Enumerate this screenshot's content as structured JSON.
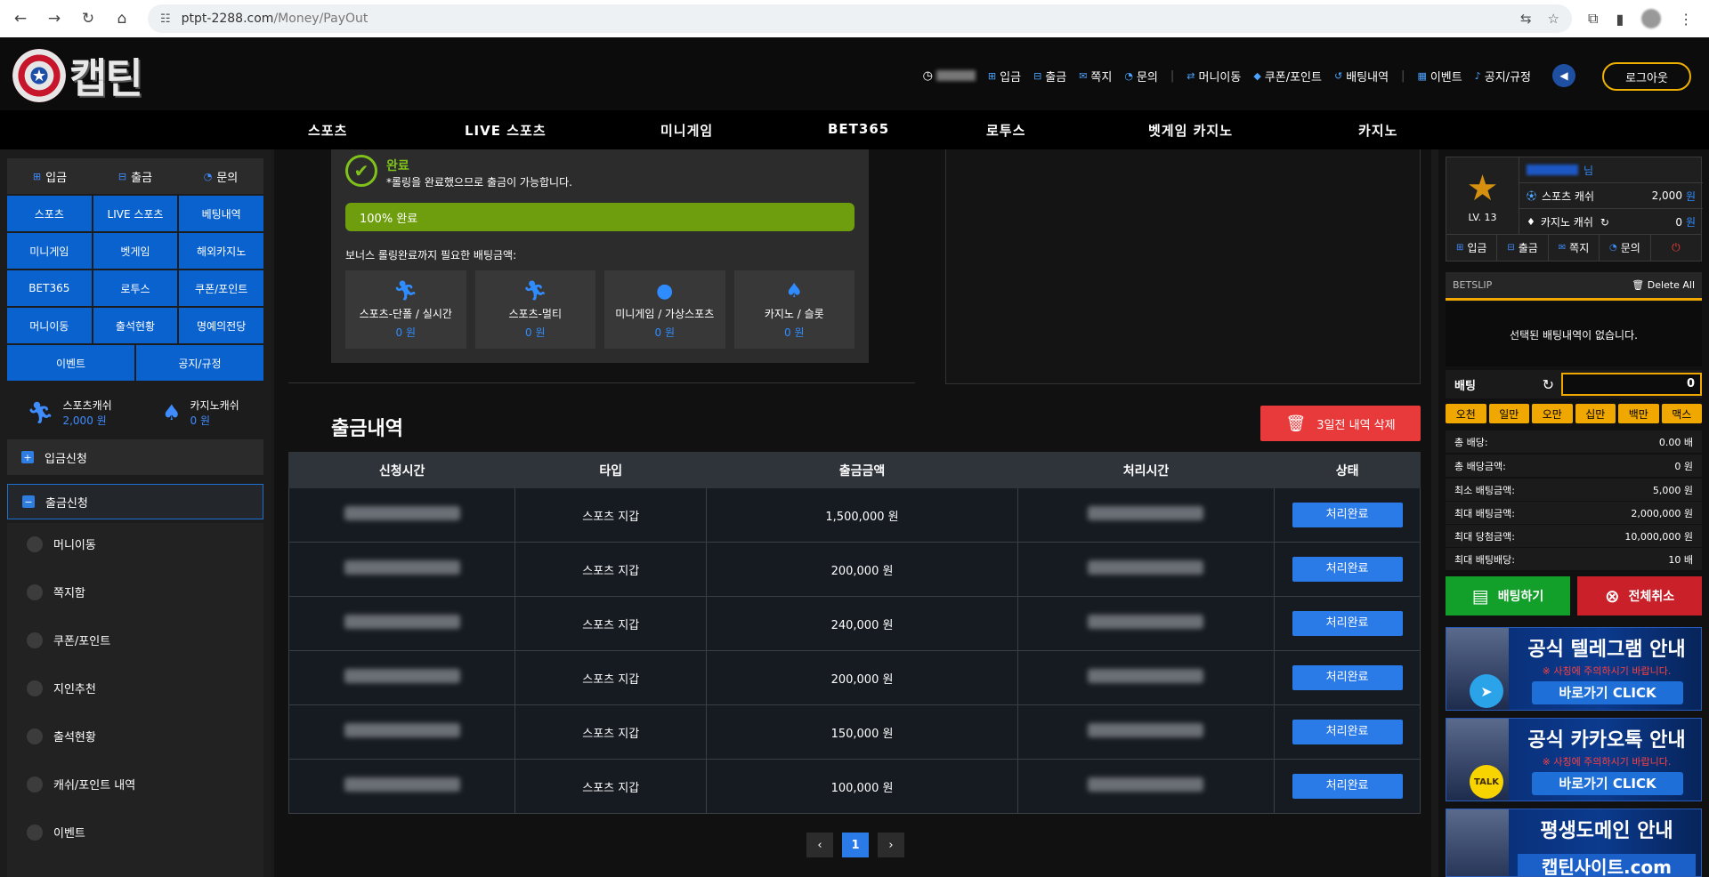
{
  "browser": {
    "url_host": "ptpt-2288.com",
    "url_path": "/Money/PayOut"
  },
  "header": {
    "logo_text": "캡틴",
    "menu": [
      {
        "label": "입금",
        "icon": "plus-square-icon"
      },
      {
        "label": "출금",
        "icon": "minus-square-icon"
      },
      {
        "label": "쪽지",
        "icon": "mail-icon"
      },
      {
        "label": "문의",
        "icon": "chat-icon"
      },
      {
        "label": "머니이동",
        "icon": "transfer-icon"
      },
      {
        "label": "쿠폰/포인트",
        "icon": "tag-icon"
      },
      {
        "label": "배팅내역",
        "icon": "history-icon"
      },
      {
        "label": "이벤트",
        "icon": "calendar-icon"
      },
      {
        "label": "공지/규정",
        "icon": "bell-icon"
      }
    ],
    "logout_label": "로그아웃"
  },
  "mainnav": [
    "스포츠",
    "LIVE 스포츠",
    "미니게임",
    "BET365",
    "로투스",
    "벳게임 카지노",
    "카지노"
  ],
  "left": {
    "top_row": [
      {
        "label": "입금",
        "icon": "plus-square-icon"
      },
      {
        "label": "출금",
        "icon": "minus-square-icon"
      },
      {
        "label": "문의",
        "icon": "chat-icon"
      }
    ],
    "buttons": [
      "스포츠",
      "LIVE 스포츠",
      "베팅내역",
      "미니게임",
      "벳게임",
      "해외카지노",
      "BET365",
      "로투스",
      "쿠폰/포인트",
      "머니이동",
      "출석현황",
      "명예의전당"
    ],
    "buttons2": [
      "이벤트",
      "공지/규정"
    ],
    "sports_cash_label": "스포츠캐쉬",
    "sports_cash_value": "2,000 원",
    "casino_cash_label": "카지노캐쉬",
    "casino_cash_value": "0 원",
    "deposit_request": "입금신청",
    "withdraw_request": "출금신청",
    "submenu": [
      "머니이동",
      "쪽지함",
      "쿠폰/포인트",
      "지인추천",
      "출석현황",
      "캐쉬/포인트 내역",
      "이벤트"
    ]
  },
  "bonus": {
    "status_title": "완료",
    "status_desc": "*롤링을 완료했으므로 출금이 가능합니다.",
    "progress_label": "100% 완료",
    "progress_percent": 100,
    "required_label": "보너스 롤링완료까지 필요한 배팅금액:",
    "cards": [
      {
        "label": "스포츠-단폴 / 실시간",
        "value": "0 원",
        "icon": "runner-icon"
      },
      {
        "label": "스포츠-멀티",
        "value": "0 원",
        "icon": "runner-icon"
      },
      {
        "label": "미니게임 / 가상스포츠",
        "value": "0 원",
        "icon": "ball-icon"
      },
      {
        "label": "카지노 / 슬롯",
        "value": "0 원",
        "icon": "cards-icon"
      }
    ]
  },
  "payout": {
    "title": "출금내역",
    "delete_label": "3일전 내역 삭제",
    "headers": [
      "신청시간",
      "타입",
      "출금금액",
      "처리시간",
      "상태"
    ],
    "rows": [
      {
        "type": "스포츠 지갑",
        "amount": "1,500,000 원",
        "status": "처리완료"
      },
      {
        "type": "스포츠 지갑",
        "amount": "200,000 원",
        "status": "처리완료"
      },
      {
        "type": "스포츠 지갑",
        "amount": "240,000 원",
        "status": "처리완료"
      },
      {
        "type": "스포츠 지갑",
        "amount": "200,000 원",
        "status": "처리완료"
      },
      {
        "type": "스포츠 지갑",
        "amount": "150,000 원",
        "status": "처리완료"
      },
      {
        "type": "스포츠 지갑",
        "amount": "100,000 원",
        "status": "처리완료"
      }
    ],
    "page": "1"
  },
  "right": {
    "user_suffix": "님",
    "level": "LV. 13",
    "sports_cash_label": "스포츠 캐쉬",
    "sports_cash_value": "2,000",
    "casino_cash_label": "카지노 캐쉬",
    "casino_cash_value": "0",
    "won": "원",
    "user_buttons": [
      "입금",
      "출금",
      "쪽지",
      "문의"
    ],
    "betslip_title": "BETSLIP",
    "delete_all": "Delete All",
    "no_selection": "선택된 배팅내역이 없습니다.",
    "bet_label": "배팅",
    "bet_value": "0",
    "chips": [
      "오천",
      "일만",
      "오만",
      "십만",
      "백만",
      "맥스"
    ],
    "info": [
      {
        "label": "총 배당:",
        "value": "0.00 배"
      },
      {
        "label": "총 배당금액:",
        "value": "0 원"
      },
      {
        "label": "최소 배팅금액:",
        "value": "5,000 원"
      },
      {
        "label": "최대 배팅금액:",
        "value": "2,000,000 원"
      },
      {
        "label": "최대 당첨금액:",
        "value": "10,000,000 원"
      },
      {
        "label": "최대 배팅배당:",
        "value": "10 배"
      }
    ],
    "bet_button": "배팅하기",
    "cancel_button": "전체취소",
    "banners": [
      {
        "title": "공식 텔레그램 안내",
        "notice": "※ 사칭에 주의하시기 바랍니다.",
        "cta": "바로가기 CLICK",
        "icon": "telegram-icon"
      },
      {
        "title": "공식 카카오톡 안내",
        "notice": "※ 사칭에 주의하시기 바랍니다.",
        "cta": "바로가기 CLICK",
        "icon": "kakaotalk-icon",
        "icon_text": "TALK"
      },
      {
        "title": "평생도메인 안내",
        "cta": "캡틴사이트.com"
      }
    ]
  }
}
